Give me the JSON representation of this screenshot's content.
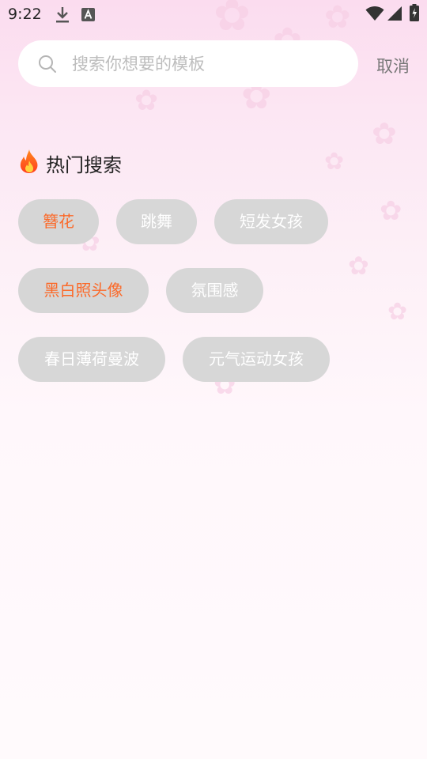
{
  "status_bar": {
    "time": "9:22",
    "icons": [
      "download-icon",
      "font-icon",
      "wifi-icon",
      "signal-icon",
      "battery-charging-icon"
    ]
  },
  "search": {
    "placeholder": "搜索你想要的模板",
    "value": "",
    "icon": "search-icon",
    "cancel_label": "取消"
  },
  "hot_search": {
    "title": "热门搜索",
    "icon": "fire-icon",
    "tags": [
      {
        "label": "簪花",
        "highlight": true
      },
      {
        "label": "跳舞",
        "highlight": false
      },
      {
        "label": "短发女孩",
        "highlight": false
      },
      {
        "label": "黑白照头像",
        "highlight": true
      },
      {
        "label": "氛围感",
        "highlight": false
      },
      {
        "label": "春日薄荷曼波",
        "highlight": false
      },
      {
        "label": "元气运动女孩",
        "highlight": false
      }
    ]
  },
  "colors": {
    "highlight_tag_text": "#fb6a2a",
    "tag_background": "#d7d7d7",
    "tag_text": "#ffffff",
    "background_top": "#fbdcef",
    "background_bottom": "#fffafc"
  }
}
